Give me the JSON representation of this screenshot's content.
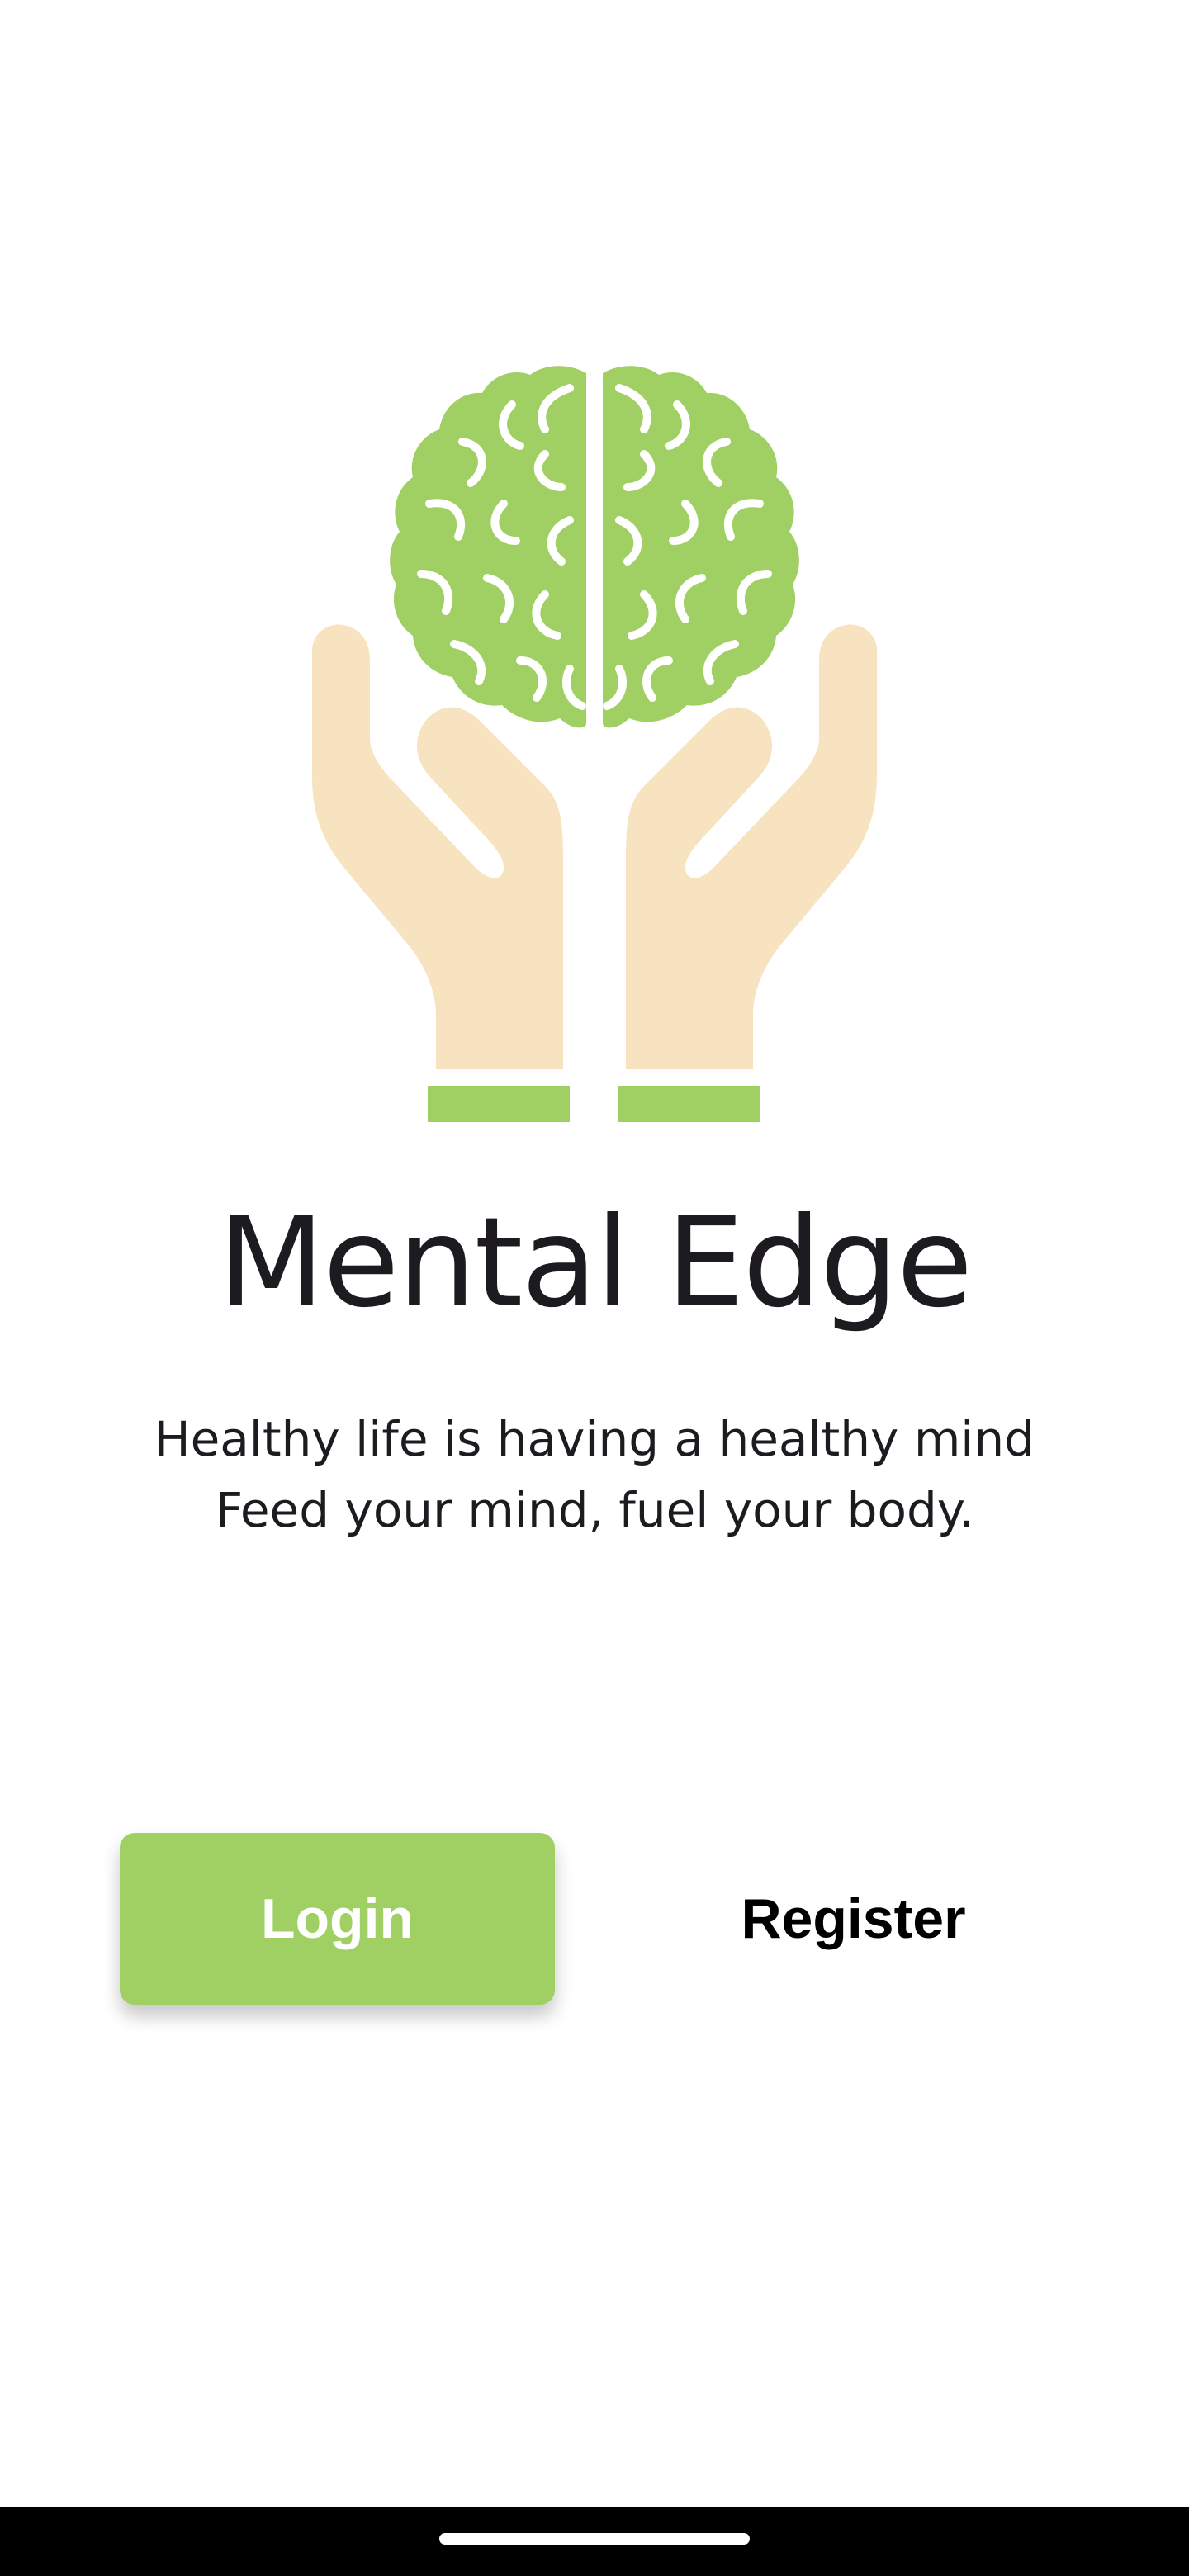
{
  "app": {
    "title": "Mental Edge",
    "tagline_line1": "Healthy life is having a healthy mind",
    "tagline_line2": "Feed your mind, fuel your body."
  },
  "actions": {
    "login_label": "Login",
    "register_label": "Register"
  },
  "logo": {
    "icon": "brain-in-hands-icon",
    "brain_color": "#a0cf64",
    "hands_color": "#f8e3c0"
  },
  "colors": {
    "accent": "#a0cf64",
    "text": "#1d1b20",
    "background": "#ffffff"
  }
}
